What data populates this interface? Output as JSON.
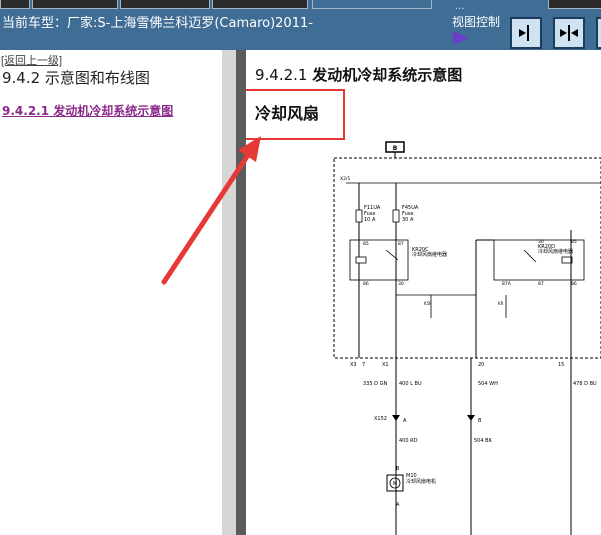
{
  "header": {
    "title": "当前车型：厂家:S-上海雪佛兰科迈罗(Camaro)2011-",
    "view_control_label": "视图控制",
    "dots": "...",
    "buttons": [
      "collapse-left-icon",
      "split-view-icon",
      "more-icon"
    ]
  },
  "left": {
    "back_link": "[返回上一级]",
    "heading": "9.4.2 示意图和布线图",
    "link": "9.4.2.1 发动机冷却系统示意图"
  },
  "right": {
    "section_number": "9.4.2.1",
    "section_title": "发动机冷却系统示意图",
    "fan_label": "冷却风扇"
  },
  "diagram": {
    "connector_top": "B",
    "fuse1_id": "F11UA",
    "fuse1_name": "Fuse",
    "fuse1_rating": "10 A",
    "fuse2_id": "F45UA",
    "fuse2_name": "Fuse",
    "fuse2_rating": "30 A",
    "relay1_id": "KR20C",
    "relay1_desc": "冷却风扇继电器",
    "relay2_id": "KR20D",
    "relay2_desc": "冷却风扇继电器",
    "box_label": "X2/1",
    "pin_labels": [
      "85",
      "87",
      "86",
      "30",
      "30",
      "87",
      "85",
      "86",
      "87A",
      "86"
    ],
    "wire1": "335 D GN",
    "wire2": "400 L BU",
    "wire3": "504 WH",
    "wire4": "478 D BU",
    "wire5": "400 RD",
    "wire6": "504 BK",
    "conn_x3": "X3",
    "conn_x1": "X1",
    "conn_7": "7",
    "conn_20": "20",
    "conn_15": "15",
    "x152": "X152",
    "motor_id": "M10",
    "motor_desc": "冷却风扇电机",
    "pins_AB": [
      "A",
      "B",
      "A",
      "B"
    ]
  }
}
